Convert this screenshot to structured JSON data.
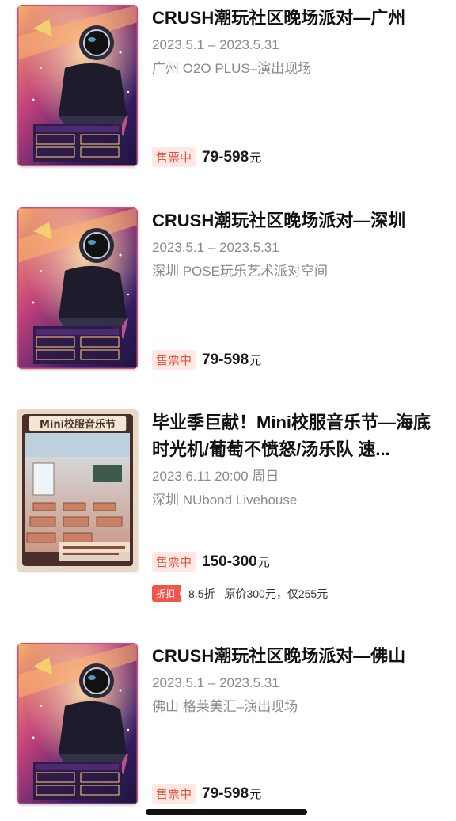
{
  "events": [
    {
      "title": "CRUSH潮玩社区晚场派对—广州",
      "date": "2023.5.1 – 2023.5.31",
      "venue": "广州 O2O PLUS–演出现场",
      "status": "售票中",
      "price": "79-598",
      "currency": "元"
    },
    {
      "title": "CRUSH潮玩社区晚场派对—深圳",
      "date": "2023.5.1 – 2023.5.31",
      "venue": "深圳 POSE玩乐艺术派对空间",
      "status": "售票中",
      "price": "79-598",
      "currency": "元"
    },
    {
      "title": "毕业季巨献！Mini校服音乐节—海底时光机/葡萄不愤怒/汤乐队 速...",
      "date": "2023.6.11 20:00 周日",
      "venue": "深圳 NUbond Livehouse",
      "status": "售票中",
      "price": "150-300",
      "currency": "元",
      "discount_tag": "折扣",
      "discount_rate": "8.5折",
      "discount_detail": "原价300元，仅255元",
      "poster_title": "Mini校服音乐节"
    },
    {
      "title": "CRUSH潮玩社区晚场派对—佛山",
      "date": "2023.5.1 – 2023.5.31",
      "venue": "佛山 格莱美汇–演出现场",
      "status": "售票中",
      "price": "79-598",
      "currency": "元"
    }
  ]
}
